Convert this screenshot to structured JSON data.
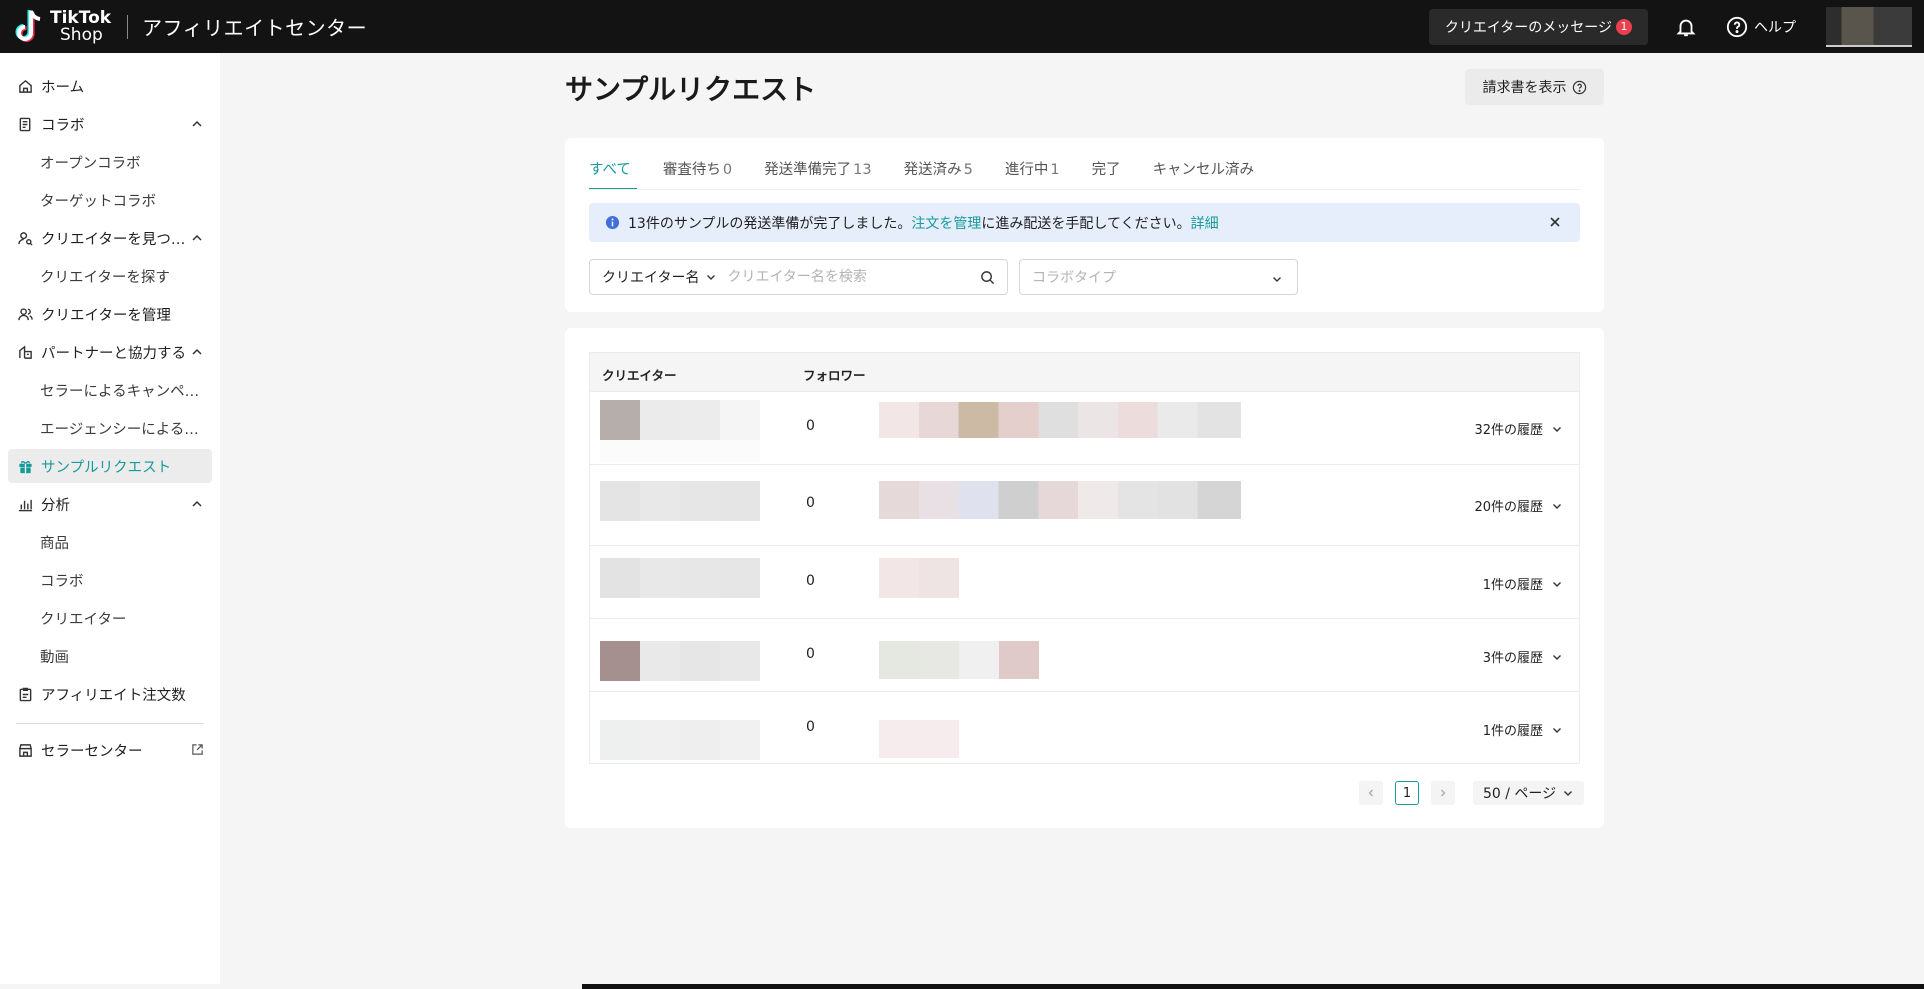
{
  "header": {
    "logo_line1": "TikTok",
    "logo_line2": "Shop",
    "app_title": "アフィリエイトセンター",
    "creator_messages_label": "クリエイターのメッセージ",
    "creator_messages_count": "1",
    "help_label": "ヘルプ"
  },
  "sidebar": {
    "home": "ホーム",
    "collab": "コラボ",
    "open_collab": "オープンコラボ",
    "target_collab": "ターゲットコラボ",
    "find_creators": "クリエイターを見つ…",
    "search_creators": "クリエイターを探す",
    "manage_creators": "クリエイターを管理",
    "partner": "パートナーと協力する",
    "seller_campaign": "セラーによるキャンペ…",
    "agency": "エージェンシーによる…",
    "sample_request": "サンプルリクエスト",
    "analytics": "分析",
    "products": "商品",
    "analytics_collab": "コラボ",
    "analytics_creators": "クリエイター",
    "videos": "動画",
    "affiliate_orders": "アフィリエイト注文数",
    "seller_center": "セラーセンター"
  },
  "main": {
    "title": "サンプルリクエスト",
    "invoice_button": "請求書を表示",
    "tabs": [
      {
        "label": "すべて",
        "count": ""
      },
      {
        "label": "審査待ち",
        "count": "0"
      },
      {
        "label": "発送準備完了",
        "count": "13"
      },
      {
        "label": "発送済み",
        "count": "5"
      },
      {
        "label": "進行中",
        "count": "1"
      },
      {
        "label": "完了",
        "count": ""
      },
      {
        "label": "キャンセル済み",
        "count": ""
      }
    ],
    "info": {
      "text_before": "13件のサンプルの発送準備が完了しました。",
      "link_manage": "注文を管理",
      "text_after": "に進み配送を手配してください。",
      "link_details": "詳細"
    },
    "search": {
      "field_selector": "クリエイター名",
      "placeholder": "クリエイター名を検索"
    },
    "collab_type_placeholder": "コラボタイプ",
    "table": {
      "col_creator": "クリエイター",
      "col_follower": "フォロワー",
      "rows": [
        {
          "followers": "0",
          "history": "32件の履歴"
        },
        {
          "followers": "0",
          "history": "20件の履歴"
        },
        {
          "followers": "0",
          "history": "1件の履歴"
        },
        {
          "followers": "0",
          "history": "3件の履歴"
        },
        {
          "followers": "0",
          "history": "1件の履歴"
        }
      ]
    },
    "pagination": {
      "current_page": "1",
      "page_size": "50 / ページ"
    }
  },
  "colors": {
    "accent": "#169a9a",
    "topbar": "#131313",
    "badge": "#e8414d",
    "info_bg": "#e6eefb"
  }
}
